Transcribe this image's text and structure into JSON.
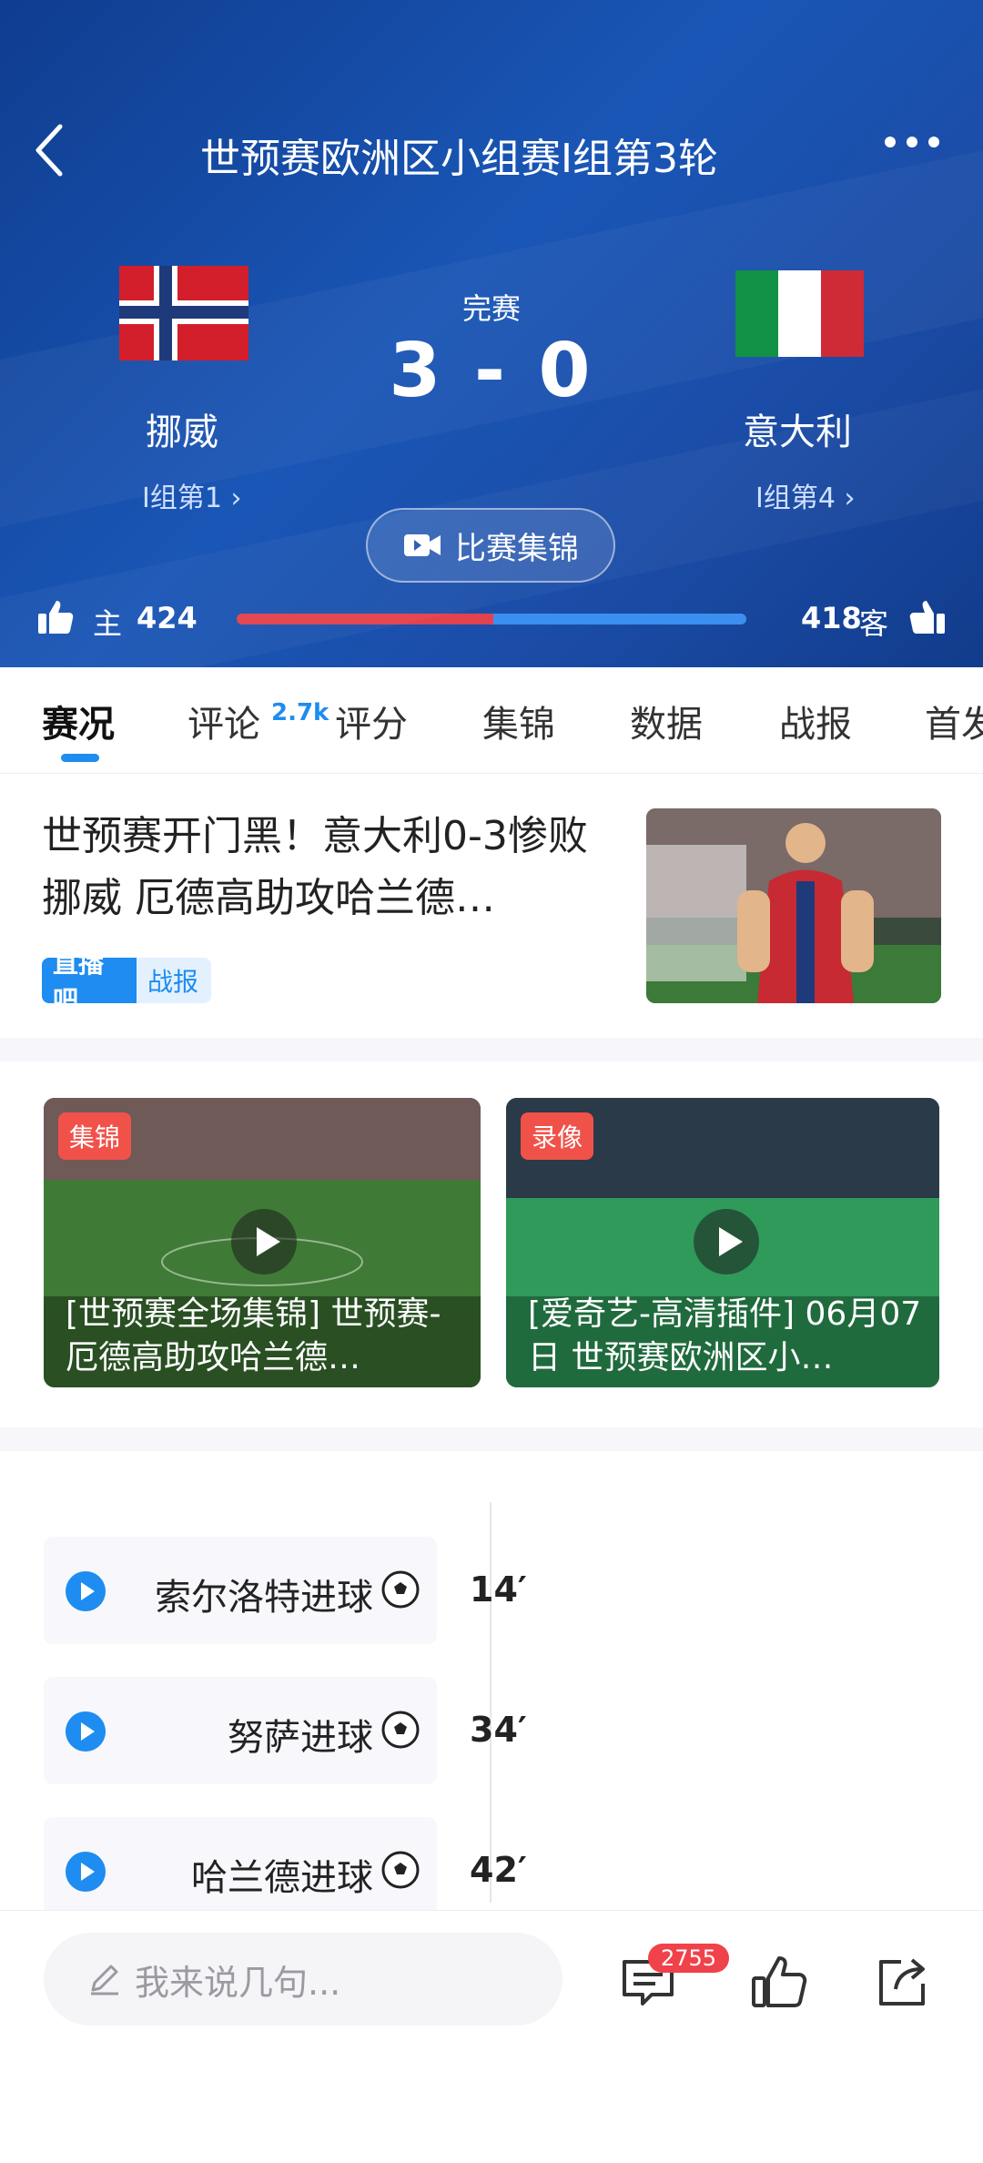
{
  "header": {
    "title": "世预赛欧洲区小组赛I组第3轮",
    "back_icon": "chevron-left-icon",
    "more_icon": "more-horizontal-icon"
  },
  "match": {
    "status": "完赛",
    "score": "3 - 0",
    "home": {
      "name": "挪威",
      "rank": "I组第1",
      "flag": "norway-flag"
    },
    "away": {
      "name": "意大利",
      "rank": "I组第4",
      "flag": "italy-flag"
    },
    "highlight_button": "比赛集锦"
  },
  "votes": {
    "home_label": "主",
    "home_count": "424",
    "away_label": "客",
    "away_count": "418",
    "home_fraction": 0.504,
    "home_color": "#e2424d",
    "away_color": "#3b8ff0"
  },
  "tabs": [
    {
      "label": "赛况",
      "active": true
    },
    {
      "label": "评论",
      "badge": "2.7k"
    },
    {
      "label": "评分"
    },
    {
      "label": "集锦"
    },
    {
      "label": "数据"
    },
    {
      "label": "战报"
    },
    {
      "label": "首发"
    }
  ],
  "article": {
    "title": "世预赛开门黑！意大利0-3惨败挪威 厄德高助攻哈兰德…",
    "tag_source": "直播吧",
    "tag_type": "战报"
  },
  "videos": [
    {
      "tag": "集锦",
      "title": "[世预赛全场集锦] 世预赛-厄德高助攻哈兰德…"
    },
    {
      "tag": "录像",
      "title": "[爱奇艺-高清插件] 06月07日 世预赛欧洲区小…"
    }
  ],
  "events": [
    {
      "label": "索尔洛特进球",
      "minute": "14′"
    },
    {
      "label": "努萨进球",
      "minute": "34′"
    },
    {
      "label": "哈兰德进球",
      "minute": "42′"
    }
  ],
  "bottom": {
    "placeholder": "我来说几句...",
    "comment_count": "2755"
  },
  "colors": {
    "accent": "#1e8cf0",
    "hero_bg": "#1a56b6",
    "tag_red": "#f0524a"
  }
}
